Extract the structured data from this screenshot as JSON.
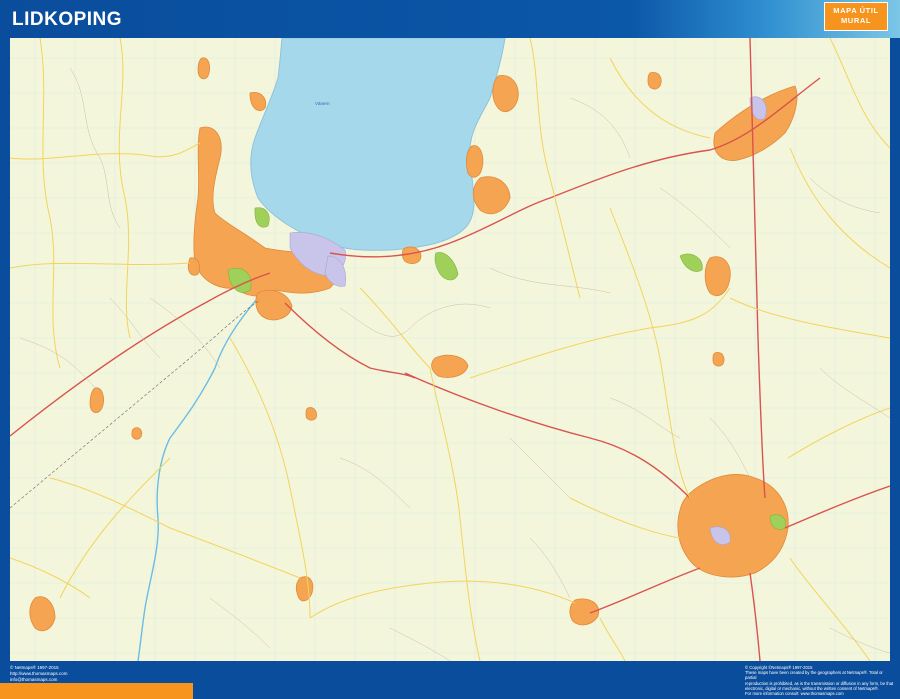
{
  "header": {
    "title": "LIDKOPING",
    "badge_line1": "MAPA ÚTIL",
    "badge_line2": "MURAL"
  },
  "map": {
    "lake_label": "Vänern",
    "colors": {
      "land": "#f4f6dc",
      "water": "#a6d8ec",
      "urban": "#f5a451",
      "park": "#9fd05a",
      "industrial": "#c8c4ea",
      "main_road": "#d9534f",
      "secondary_road": "#f2d45c",
      "river": "#6bbce6"
    }
  },
  "footer": {
    "left_lines": [
      "© Netmaps® 1997-2015",
      "http://www.thomasmaps.com",
      "info@thomasmaps.com"
    ],
    "right_lines": [
      "© Copyright ©Netmaps® 1997-2015",
      "These maps have been created by the geographers at Netmaps®. Total or partial",
      "reproduction is prohibited, as is the transmission or diffusion in any form, be that",
      "electronic, digital or mechanic, without the written consent of Netmaps®.",
      "For more information consult: www.thomasmaps.com"
    ]
  }
}
